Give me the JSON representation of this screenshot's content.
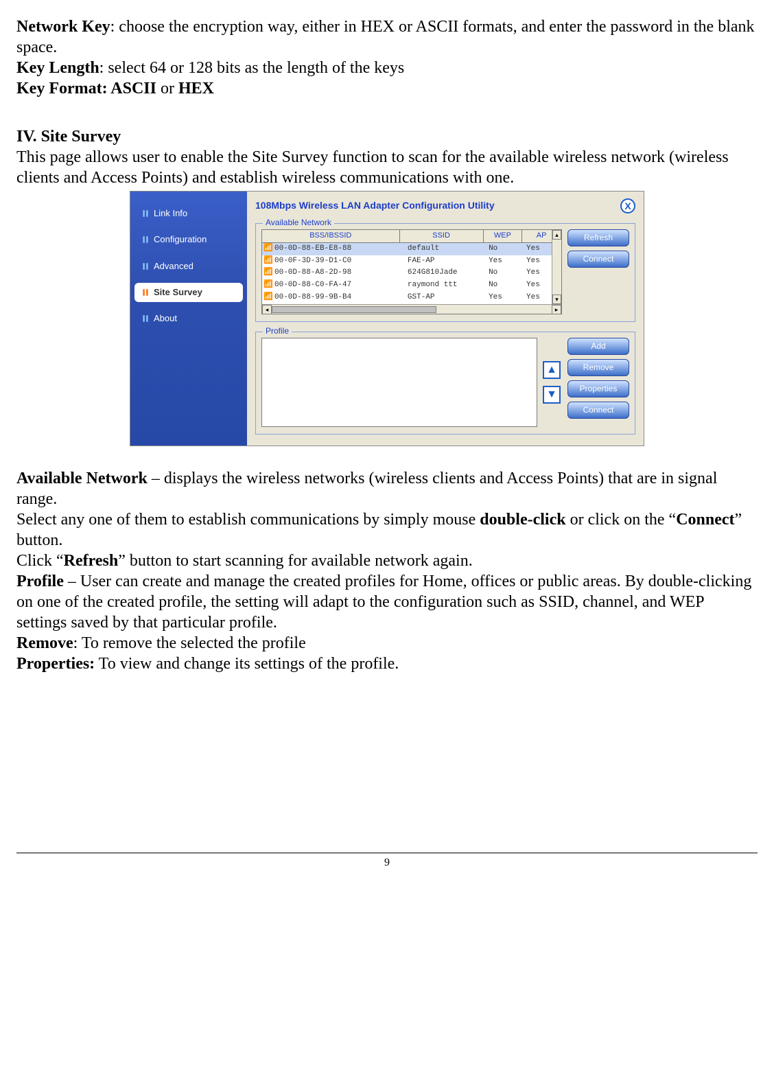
{
  "text": {
    "p1_b": "Network Key",
    "p1": ": choose the encryption way, either in HEX or ASCII formats, and enter the password in the blank space.",
    "p2_b": "Key Length",
    "p2": ": select 64 or 128 bits as the length of the keys",
    "p3_b": "Key Format: ASCII",
    "p3_mid": " or ",
    "p3_b2": "HEX",
    "heading": "IV. Site Survey",
    "intro": "This page allows user to enable the Site Survey function to scan for the available wireless network (wireless clients and Access Points) and establish wireless communications with one.",
    "availnet_b": "Available Network",
    "availnet": " – displays the wireless networks (wireless clients and Access Points) that are in signal range.",
    "sel_pre": "Select any one of them to establish communications by simply mouse ",
    "sel_b": "double-click",
    "sel_post": " or click on the “",
    "sel_b2": "Connect",
    "sel_end": "” button.",
    "refresh_pre": "Click “",
    "refresh_b": "Refresh",
    "refresh_post": "” button to start scanning for available network again.",
    "profile_b": "Profile",
    "profile": " – User can create and manage the created profiles for Home, offices or public areas. By double-clicking on one of the created profile, the setting will adapt to the configuration such as SSID, channel, and WEP settings saved by that particular profile.",
    "remove_b": "Remove",
    "remove": ": To remove the selected the profile",
    "props_b": "Properties:",
    "props": " To view and change its settings of the profile.",
    "pagenum": "9"
  },
  "util": {
    "title": "108Mbps Wireless LAN Adapter Configuration Utility",
    "close": "X",
    "nav": {
      "link_info": "Link Info",
      "configuration": "Configuration",
      "advanced": "Advanced",
      "site_survey": "Site Survey",
      "about": "About"
    },
    "groups": {
      "available": "Available Network",
      "profile": "Profile"
    },
    "columns": {
      "bss": "BSS/IBSSID",
      "ssid": "SSID",
      "wep": "WEP",
      "ap": "AP"
    },
    "rows": [
      {
        "bss": "00-0D-88-EB-E8-88",
        "ssid": "default",
        "wep": "No",
        "ap": "Yes",
        "selected": true,
        "icon": "ap"
      },
      {
        "bss": "00-0F-3D-39-D1-C0",
        "ssid": "FAE-AP",
        "wep": "Yes",
        "ap": "Yes",
        "selected": false,
        "icon": "ap"
      },
      {
        "bss": "00-0D-88-A8-2D-98",
        "ssid": "624G810Jade",
        "wep": "No",
        "ap": "Yes",
        "selected": false,
        "icon": "ap"
      },
      {
        "bss": "00-0D-88-C0-FA-47",
        "ssid": "raymond ttt",
        "wep": "No",
        "ap": "Yes",
        "selected": false,
        "icon": "ap"
      },
      {
        "bss": "00-0D-88-99-9B-B4",
        "ssid": "GST-AP",
        "wep": "Yes",
        "ap": "Yes",
        "selected": false,
        "icon": "ap"
      }
    ],
    "buttons": {
      "refresh": "Refresh",
      "connect": "Connect",
      "add": "Add",
      "remove": "Remove",
      "properties": "Properties",
      "connect2": "Connect"
    }
  }
}
